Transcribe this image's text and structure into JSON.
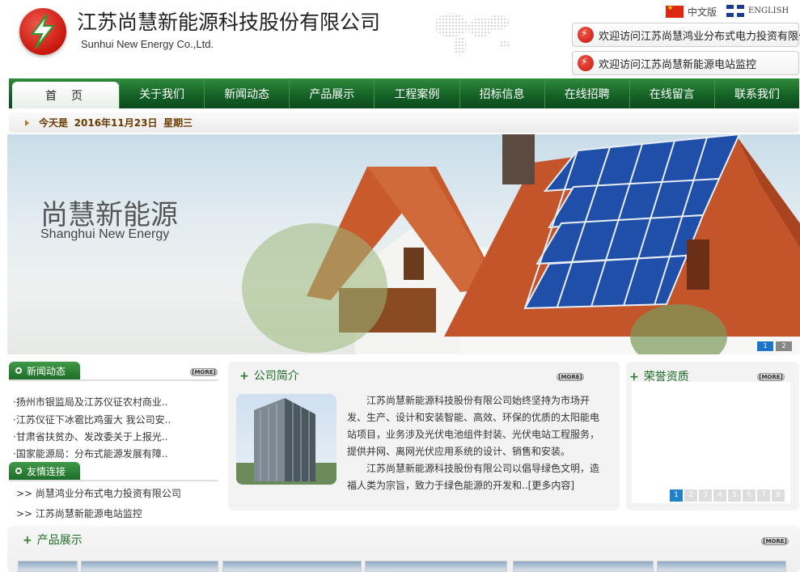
{
  "header": {
    "title_cn": "江苏尚慧新能源科技股份有限公司",
    "title_en": "Sunhui New Energy Co.,Ltd.",
    "lang_cn": "中文版",
    "lang_en": "ENGLISH",
    "visit_links": [
      "欢迎访问江苏尚慧鸿业分布式电力投资有限公司",
      "欢迎访问江苏尚慧新能源电站监控"
    ]
  },
  "nav": {
    "home": "首页",
    "items": [
      "关于我们",
      "新闻动态",
      "产品展示",
      "工程案例",
      "招标信息",
      "在线招聘",
      "在线留言",
      "联系我们"
    ]
  },
  "datebar": {
    "prefix": "今天是",
    "date": "2016年11月23日",
    "weekday": "星期三"
  },
  "banner": {
    "title_cn": "尚慧新能源",
    "title_en": "Shanghui New Energy",
    "slides": [
      "1",
      "2"
    ]
  },
  "news": {
    "title": "新闻动态",
    "more": "[MORE]",
    "items": [
      "·扬州市银监局及江苏仪征农村商业..",
      "·江苏仪征下冰雹比鸡蛋大 我公司安..",
      "·甘肃省扶贫办、发改委关于上报光..",
      "·国家能源局：分布式能源发展有障.."
    ]
  },
  "links": {
    "title": "友情连接",
    "items": [
      ">> 尚慧鸿业分布式电力投资有限公司",
      ">> 江苏尚慧新能源电站监控"
    ]
  },
  "intro": {
    "title": "公司简介",
    "more": "[MORE]",
    "para1": "江苏尚慧新能源科技股份有限公司始终坚持为市场开发、生产、设计和安装智能、高效、环保的优质的太阳能电站项目，业务涉及光伏电池组件封装、光伏电站工程服务，提供并网、离网光伏应用系统的设计、销售和安装。",
    "para2": "江苏尚慧新能源科技股份有限公司以倡导绿色文明，造福人类为宗旨，致力于绿色能源的开发和..",
    "read_more": "[更多内容]"
  },
  "honor": {
    "title": "荣誉资质",
    "more": "[MORE]",
    "pages": [
      "1",
      "2",
      "3",
      "4",
      "5",
      "6",
      "7",
      "8"
    ]
  },
  "products": {
    "title": "产品展示",
    "more": "[MORE]"
  },
  "colors": {
    "nav_green": "#146026",
    "accent_green": "#2a7a2e",
    "roof": "#c85a2c",
    "panel_blue": "#1f4fa8"
  }
}
